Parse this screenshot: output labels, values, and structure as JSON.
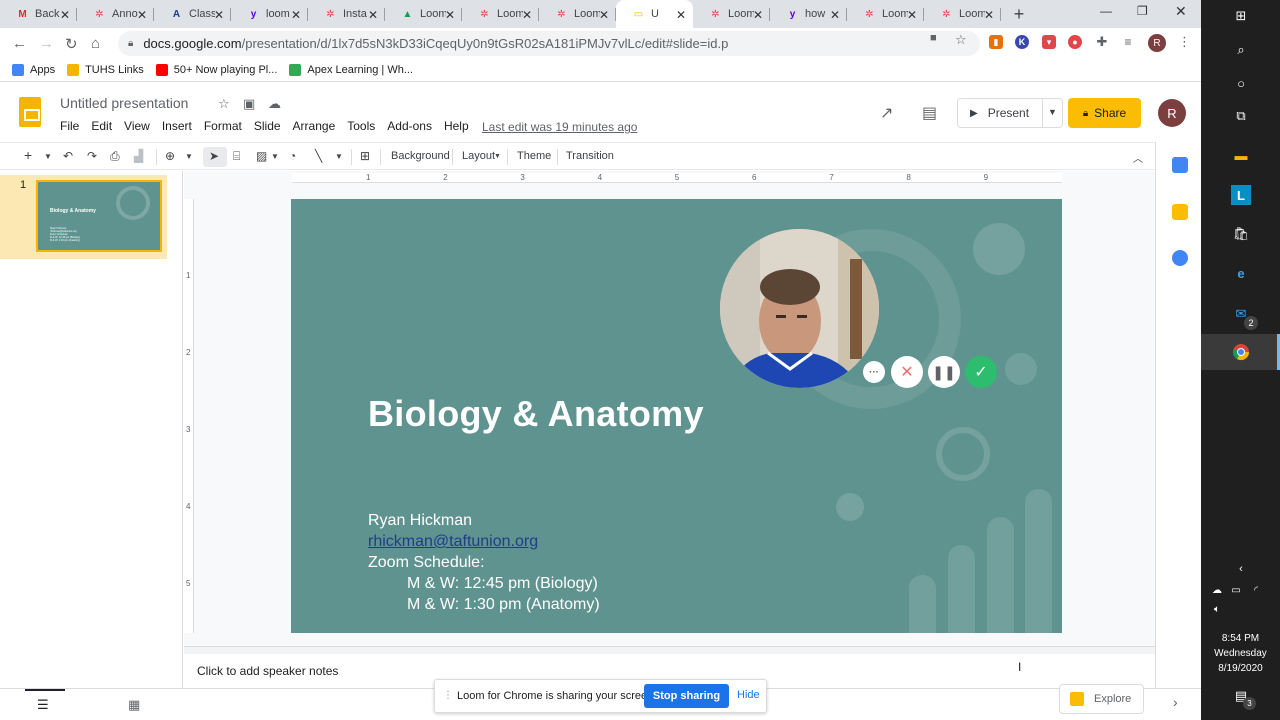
{
  "browser": {
    "tabs": [
      {
        "label": "Back",
        "favicon": "gmail-icon",
        "color": "#d93025",
        "glyph": "M"
      },
      {
        "label": "Anno",
        "favicon": "loom-icon",
        "color": "#e0474c",
        "glyph": "✲"
      },
      {
        "label": "Class",
        "favicon": "apex-icon",
        "color": "#1a3c8a",
        "glyph": "A"
      },
      {
        "label": "loom",
        "favicon": "yahoo-icon",
        "color": "#6001d2",
        "glyph": "y"
      },
      {
        "label": "Insta",
        "favicon": "loom-icon",
        "color": "#e0474c",
        "glyph": "✲"
      },
      {
        "label": "Loom",
        "favicon": "drive-icon",
        "color": "#0f9d58",
        "glyph": "▲"
      },
      {
        "label": "Loom",
        "favicon": "loom-icon",
        "color": "#e0474c",
        "glyph": "✲"
      },
      {
        "label": "Loom",
        "favicon": "loom-icon",
        "color": "#e0474c",
        "glyph": "✲"
      },
      {
        "label": "U",
        "favicon": "slides-icon",
        "color": "#f4b400",
        "glyph": "▭",
        "active": true
      },
      {
        "label": "Loom",
        "favicon": "loom-icon",
        "color": "#e0474c",
        "glyph": "✲"
      },
      {
        "label": "how",
        "favicon": "yahoo-icon",
        "color": "#6001d2",
        "glyph": "y"
      },
      {
        "label": "Loom",
        "favicon": "loom-icon",
        "color": "#e0474c",
        "glyph": "✲"
      },
      {
        "label": "Loom",
        "favicon": "loom-icon",
        "color": "#e0474c",
        "glyph": "✲"
      }
    ],
    "url_domain": "docs.google.com",
    "url_path": "/presentation/d/1lx7d5sN3kD33iCqeqUy0n9tGsR02sA181iPMJv7vlLc/edit#slide=id.p",
    "bookmarks": [
      {
        "label": "Apps",
        "icon": "apps-grid-icon",
        "color": "#4285f4"
      },
      {
        "label": "TUHS Links",
        "icon": "folder-icon",
        "color": "#f4b400"
      },
      {
        "label": "50+ Now playing Pl...",
        "icon": "youtube-icon",
        "color": "#ff0000"
      },
      {
        "label": "Apex Learning | Wh...",
        "icon": "apex-icon",
        "color": "#34a853"
      }
    ],
    "avatar_initial": "R"
  },
  "slides_app": {
    "doc_title": "Untitled presentation",
    "menu": [
      "File",
      "Edit",
      "View",
      "Insert",
      "Format",
      "Slide",
      "Arrange",
      "Tools",
      "Add-ons",
      "Help"
    ],
    "last_edit": "Last edit was 19 minutes ago",
    "present_label": "Present",
    "share_label": "Share",
    "user_initial": "R",
    "toolbar": {
      "background": "Background",
      "layout": "Layout",
      "theme": "Theme",
      "transition": "Transition"
    },
    "ruler_h": [
      "1",
      "2",
      "3",
      "4",
      "5",
      "6",
      "7",
      "8",
      "9"
    ],
    "ruler_v": [
      "1",
      "2",
      "3",
      "4",
      "5"
    ],
    "slide_number": "1",
    "speaker_notes_placeholder": "Click to add speaker notes",
    "explore_label": "Explore"
  },
  "slide": {
    "title": "Biology & Anatomy",
    "name": "Ryan Hickman",
    "email": "rhickman@taftunion.org",
    "schedule_heading": "Zoom Schedule:",
    "schedule_line1": "M & W: 12:45 pm (Biology)",
    "schedule_line2": "M & W: 1:30 pm (Anatomy)",
    "bg_color": "#5f938f"
  },
  "loom": {
    "share_message": "Loom for Chrome is sharing your screen.",
    "stop_label": "Stop sharing",
    "hide_label": "Hide"
  },
  "taskbar": {
    "time": "8:54 PM",
    "day": "Wednesday",
    "date": "8/19/2020",
    "mail_badge": "2",
    "notif_badge": "3"
  }
}
